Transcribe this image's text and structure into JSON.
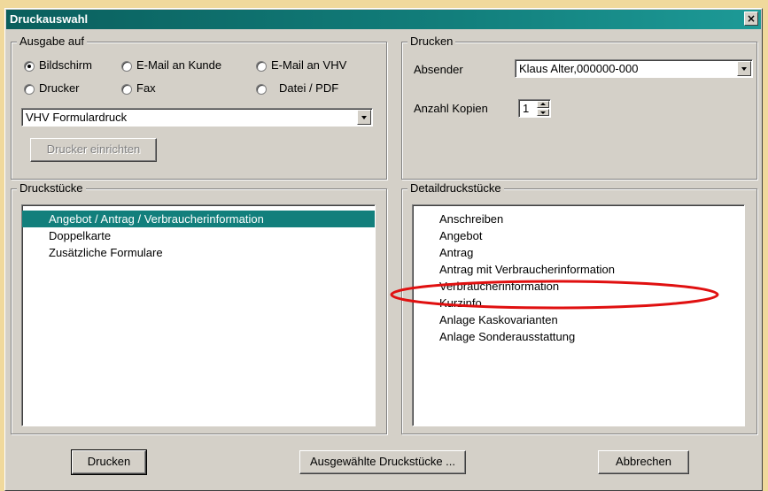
{
  "window": {
    "title": "Druckauswahl",
    "close_glyph": "×"
  },
  "ausgabe": {
    "label": "Ausgabe auf",
    "radios": [
      {
        "label": "Bildschirm",
        "checked": true
      },
      {
        "label": "E-Mail an Kunde",
        "checked": false
      },
      {
        "label": "E-Mail an VHV",
        "checked": false
      },
      {
        "label": "Drucker",
        "checked": false
      },
      {
        "label": "Fax",
        "checked": false
      },
      {
        "label": "Datei / PDF",
        "checked": false
      }
    ],
    "printer_select": "VHV Formulardruck",
    "setup_button": "Drucker einrichten"
  },
  "drucken": {
    "label": "Drucken",
    "sender_label": "Absender",
    "sender_value": "Klaus Alter,000000-000",
    "copies_label": "Anzahl Kopien",
    "copies_value": "1"
  },
  "druckstuecke": {
    "label": "Druckstücke",
    "items": [
      "Angebot / Antrag / Verbraucherinformation",
      "Doppelkarte",
      "Zusätzliche Formulare"
    ],
    "selected_index": 0
  },
  "detaildruckstuecke": {
    "label": "Detaildruckstücke",
    "items": [
      "Anschreiben",
      "Angebot",
      "Antrag",
      "Antrag mit Verbraucherinformation",
      "Verbraucherinformation",
      "Kurzinfo",
      "Anlage Kaskovarianten",
      "Anlage Sonderausstattung"
    ],
    "highlighted_index": 4
  },
  "buttons": {
    "print": "Drucken",
    "selected_items": "Ausgewählte Druckstücke ...",
    "cancel": "Abbrechen"
  },
  "colors": {
    "title_bar": "#127f7c",
    "selection": "#127f7c",
    "annotation_circle": "#e01010",
    "background": "#f0d99c"
  }
}
